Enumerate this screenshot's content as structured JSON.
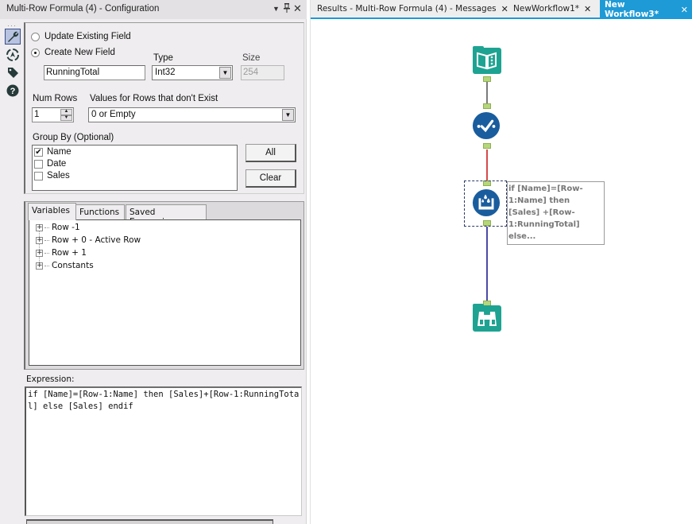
{
  "config_panel": {
    "title": "Multi-Row Formula (4) - Configuration",
    "title_controls": {
      "dropdown": "▾",
      "pin": "📌",
      "close": "✕"
    },
    "side_icons": [
      "wrench-icon",
      "navigation-icon",
      "tag-icon",
      "help-icon"
    ],
    "mode_options": [
      {
        "label": "Update Existing Field",
        "checked": false
      },
      {
        "label": "Create New  Field",
        "checked": true
      }
    ],
    "new_field_name": "RunningTotal",
    "type_label": "Type",
    "type_value": "Int32",
    "size_label": "Size",
    "size_value": "254",
    "num_rows_label": "Num Rows",
    "num_rows_value": "1",
    "nonexist_label": "Values for Rows that don't Exist",
    "nonexist_value": "0 or Empty",
    "group_by_label": "Group By (Optional)",
    "group_by_fields": [
      {
        "label": "Name",
        "checked": true
      },
      {
        "label": "Date",
        "checked": false
      },
      {
        "label": "Sales",
        "checked": false
      }
    ],
    "all_button": "All",
    "clear_button": "Clear",
    "tabs": [
      "Variables",
      "Functions",
      "Saved Expressions"
    ],
    "active_tab": "Variables",
    "tree_items": [
      "Row -1",
      "Row + 0 - Active Row",
      "Row + 1",
      "Constants"
    ],
    "expression_label": "Expression:",
    "expression": "if [Name]=[Row-1:Name] then [Sales]+[Row-1:RunningTotal] else [Sales] endif"
  },
  "canvas": {
    "tabs": [
      {
        "label": "Results - Multi-Row Formula (4) - Messages",
        "active": false
      },
      {
        "label": "NewWorkflow1*",
        "active": false
      },
      {
        "label": "New Workflow3*",
        "active": true
      }
    ],
    "nodes": [
      {
        "name": "input-data-tool",
        "icon": "book-icon",
        "color": "#1ea392"
      },
      {
        "name": "select-tool",
        "icon": "checkmark-icon",
        "color": "#1a5d9e"
      },
      {
        "name": "multi-row-formula-tool",
        "icon": "formula-bucket-icon",
        "color": "#1a5d9e"
      },
      {
        "name": "browse-tool",
        "icon": "binoculars-icon",
        "color": "#1ea392"
      }
    ],
    "connection_colors": [
      "#7a7a7a",
      "#d64a4a",
      "#4a4aa8"
    ],
    "annotation": "if [Name]=[Row-1:Name] then [Sales] +[Row-1:RunningTotal] else..."
  },
  "colors": {
    "accent": "#1e9ad6",
    "teal": "#1ea392",
    "navy": "#1a5d9e"
  }
}
